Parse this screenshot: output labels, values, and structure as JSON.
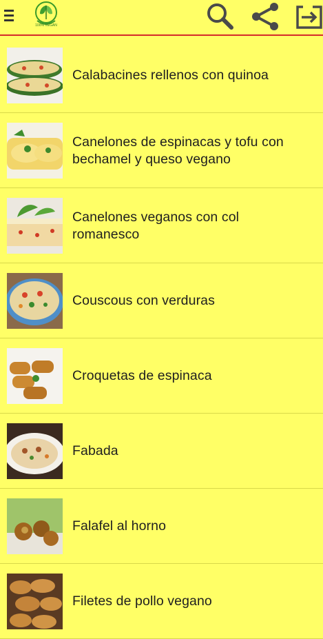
{
  "toolbar": {
    "menu_icon": "menu-icon",
    "logo_text": "100% VEGAN",
    "search_icon": "search-icon",
    "share_icon": "share-icon",
    "exit_icon": "exit-icon",
    "border_color": "#d42a2a"
  },
  "colors": {
    "background": "#ffff66",
    "divider": "#d8d84a"
  },
  "recipes": [
    {
      "label": "Calabacines rellenos con quinoa"
    },
    {
      "label": "Canelones de espinacas y tofu con bechamel y queso vegano"
    },
    {
      "label": "Canelones veganos con col romanesco"
    },
    {
      "label": "Couscous con verduras"
    },
    {
      "label": "Croquetas de espinaca"
    },
    {
      "label": "Fabada"
    },
    {
      "label": "Falafel al horno"
    },
    {
      "label": "Filetes de pollo vegano"
    }
  ]
}
